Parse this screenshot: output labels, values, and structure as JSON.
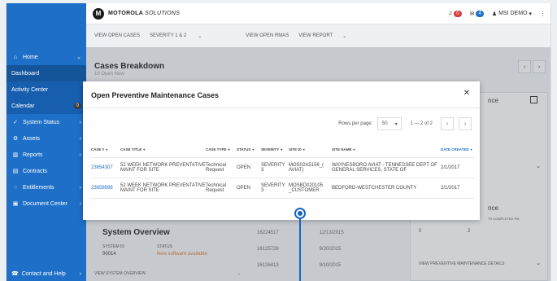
{
  "topbar": {
    "brand": "MOTOROLA",
    "brand_italic": "SOLUTIONS",
    "alerts_count": "0",
    "messages_count": "4",
    "user": "MSI DEMO"
  },
  "filterbar": {
    "view_open_cases": "VIEW OPEN CASES",
    "severity": "SEVERITY 1 & 2",
    "view_open_rmas": "VIEW OPEN RMAS",
    "view_report": "VIEW REPORT"
  },
  "sidebar": {
    "items": [
      {
        "label": "Home"
      },
      {
        "label": "Dashboard"
      },
      {
        "label": "Activity Center"
      },
      {
        "label": "Calendar",
        "badge": "0"
      },
      {
        "label": "System Status"
      },
      {
        "label": "Assets"
      },
      {
        "label": "Reports"
      },
      {
        "label": "Contracts"
      },
      {
        "label": "Entitlements"
      },
      {
        "label": "Document Center"
      }
    ],
    "bottom": "Contact and Help"
  },
  "content": {
    "cases_title": "Cases Breakdown",
    "cases_sub": "10 Open Now",
    "system_overview": "System Overview",
    "system_id_label": "SYSTEM ID",
    "system_id_value": "00014",
    "status_label": "STATUS",
    "status_value": "New software available",
    "view_system_overview": "VIEW SYSTEM OVERVIEW",
    "mid_rows": [
      {
        "id": "16224517",
        "date": "12/13/2015"
      },
      {
        "id": "16125739",
        "date": "9/20/2015"
      },
      {
        "id": "16126413",
        "date": "9/10/2015"
      }
    ],
    "rp_title1": "nce",
    "rp_title2": "nce",
    "rp_sub": "TH COMPLETED PM",
    "rp_view": "VIEW PREVENTIVE MAINTENANCE DETAILS",
    "rp_num1": "0",
    "rp_num2": "2"
  },
  "modal": {
    "title": "Open Preventive Maintenance Cases",
    "rows_per_page_label": "Rows per page:",
    "rows_per_page_value": "50",
    "range": "1 — 2 of 2",
    "headers": [
      "CASE #",
      "CASE TITLE",
      "CASE TYPE",
      "STATUS",
      "SEVERITY",
      "SITE ID",
      "SITE NAME",
      "DATE CREATED"
    ],
    "rows": [
      {
        "case": "23654307",
        "title": "52 WEEK NETWORK PREVENTATIVE MAINT FOR SITE",
        "type": "Technical Request",
        "status": "OPEN",
        "severity": "SEVERITY 3",
        "site_id": "MOS02A5156_( AVIAT)",
        "site_name": "WAYNESBORO AVIAT - TENNESSEE DEPT OF GENERAL SERVICES, STATE OF",
        "date": "2/1/2017"
      },
      {
        "case": "23658998",
        "title": "52 WEEK NETWORK PREVENTATIVE MAINT FOR SITE",
        "type": "Technical Request",
        "status": "OPEN",
        "severity": "SEVERITY 3",
        "site_id": "MOSBD020105 _CUSTOMER",
        "site_name": "BEDFORD-WESTCHESTER COUNTY",
        "date": "2/1/2017"
      }
    ]
  }
}
